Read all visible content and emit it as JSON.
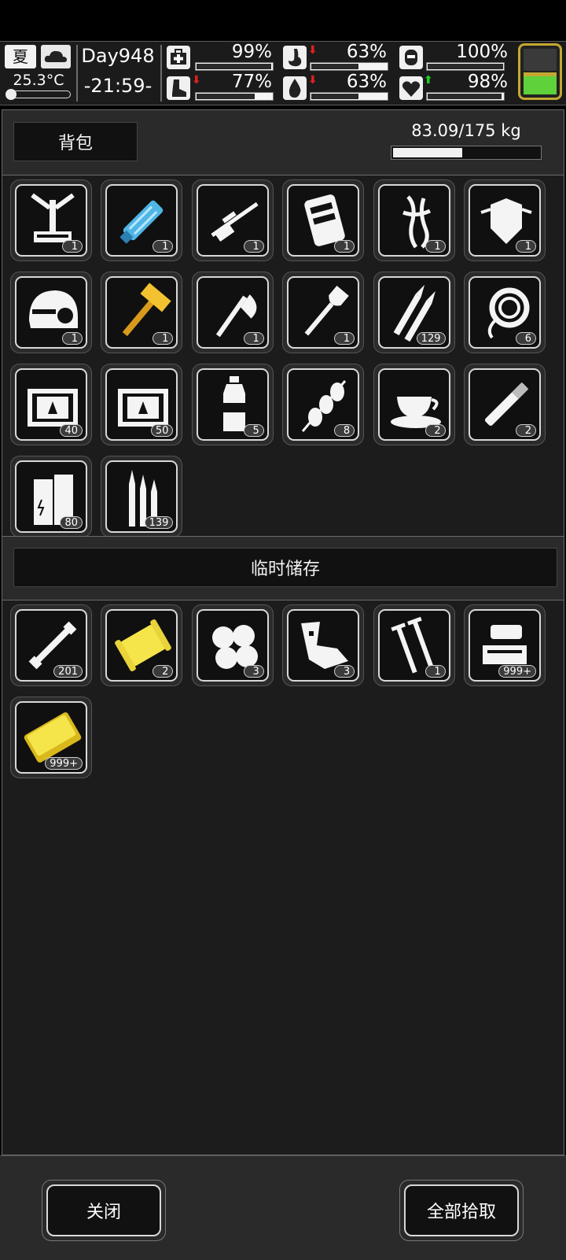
{
  "hud": {
    "season": "夏",
    "temperature": "25.3°C",
    "day": "Day948",
    "time": "-21:59-",
    "stats": [
      {
        "name": "health",
        "value": "99%",
        "fill": 0.99,
        "arrow": ""
      },
      {
        "name": "hunger",
        "value": "63%",
        "fill": 0.63,
        "arrow": "down"
      },
      {
        "name": "armor",
        "value": "100%",
        "fill": 1.0,
        "arrow": ""
      },
      {
        "name": "stamina",
        "value": "77%",
        "fill": 0.77,
        "arrow": "down"
      },
      {
        "name": "thirst",
        "value": "63%",
        "fill": 0.63,
        "arrow": "down"
      },
      {
        "name": "mood",
        "value": "98%",
        "fill": 0.98,
        "arrow": "up"
      }
    ],
    "battery_level": 0.5,
    "colors": {
      "down_arrow": "#e02020",
      "up_arrow": "#22cc22",
      "battery_green": "#5fd13a",
      "battery_rim": "#c4a832"
    }
  },
  "backpack": {
    "title": "背包",
    "weight": "83.09/175 kg",
    "weight_fill": 0.475,
    "items": [
      {
        "icon": "exoskeleton-icon",
        "count": "1"
      },
      {
        "icon": "minigun-icon",
        "count": "1"
      },
      {
        "icon": "sniper-rifle-icon",
        "count": "1"
      },
      {
        "icon": "vest-icon",
        "count": "1"
      },
      {
        "icon": "ghillie-suit-icon",
        "count": "1"
      },
      {
        "icon": "armor-plate-icon",
        "count": "1"
      },
      {
        "icon": "helmet-icon",
        "count": "1"
      },
      {
        "icon": "golden-hammer-icon",
        "count": "1"
      },
      {
        "icon": "axe-icon",
        "count": "1"
      },
      {
        "icon": "shovel-icon",
        "count": "1"
      },
      {
        "icon": "rifle-bullets-icon",
        "count": "129"
      },
      {
        "icon": "rope-icon",
        "count": "6"
      },
      {
        "icon": "supply-crate-icon",
        "count": "40"
      },
      {
        "icon": "supply-crate-icon",
        "count": "50"
      },
      {
        "icon": "water-bottle-icon",
        "count": "5"
      },
      {
        "icon": "kebab-icon",
        "count": "8"
      },
      {
        "icon": "coffee-icon",
        "count": "2"
      },
      {
        "icon": "cigarette-icon",
        "count": "2"
      },
      {
        "icon": "battery-icon",
        "count": "80"
      },
      {
        "icon": "ammo-icon",
        "count": "139"
      }
    ]
  },
  "storage": {
    "title": "临时储存",
    "items": [
      {
        "icon": "pipe-icon",
        "count": "201"
      },
      {
        "icon": "gold-spool-icon",
        "count": "2"
      },
      {
        "icon": "cotton-icon",
        "count": "3"
      },
      {
        "icon": "metal-scrap-icon",
        "count": "3"
      },
      {
        "icon": "screws-icon",
        "count": "1"
      },
      {
        "icon": "electronic-parts-icon",
        "count": "999+"
      },
      {
        "icon": "gold-plate-icon",
        "count": "999+"
      }
    ]
  },
  "buttons": {
    "close": "关闭",
    "pickup_all": "全部拾取"
  }
}
